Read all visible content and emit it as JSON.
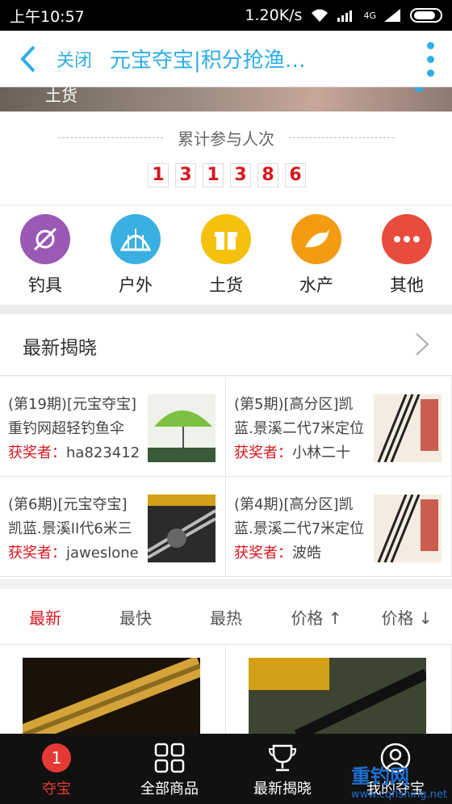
{
  "status_bar": {
    "time": "上午10:57",
    "speed": "1.20K/s",
    "net": "4G"
  },
  "app_bar": {
    "close": "关闭",
    "title": "元宝夺宝|积分抢渔…"
  },
  "banner": {
    "text": "土货"
  },
  "counter": {
    "label": "累计参与人次",
    "digits": [
      "1",
      "3",
      "1",
      "3",
      "8",
      "6"
    ]
  },
  "categories": [
    {
      "label": "钓具",
      "icon": "fishing-gear-icon",
      "color": "#9b59b6"
    },
    {
      "label": "户外",
      "icon": "tent-icon",
      "color": "#3ab0e2"
    },
    {
      "label": "土货",
      "icon": "gift-icon",
      "color": "#f4c20d"
    },
    {
      "label": "水产",
      "icon": "fish-icon",
      "color": "#f39c12"
    },
    {
      "label": "其他",
      "icon": "more-dots-icon",
      "color": "#e74c3c"
    }
  ],
  "latest": {
    "title": "最新揭晓",
    "winner_label": "获奖者：",
    "items": [
      {
        "line1": "(第19期)[元宝夺宝]",
        "line2": "重钓网超轻钓鱼伞",
        "winner": "ha823412"
      },
      {
        "line1": "(第5期)[高分区]凯",
        "line2": "蓝.景溪二代7米定位",
        "winner": "小林二十"
      },
      {
        "line1": "(第6期)[元宝夺宝]",
        "line2": "凯蓝.景溪II代6米三",
        "winner": "jaweslone"
      },
      {
        "line1": "(第4期)[高分区]凯",
        "line2": "蓝.景溪二代7米定位",
        "winner": "波皓"
      }
    ]
  },
  "sorts": [
    "最新",
    "最快",
    "最热",
    "价格",
    "价格"
  ],
  "tabs": [
    {
      "label": "夺宝",
      "badge": "1"
    },
    {
      "label": "全部商品"
    },
    {
      "label": "最新揭晓"
    },
    {
      "label": "我的夺宝"
    }
  ],
  "watermark": {
    "brand": "重钓网",
    "url": "www.cqfishing.net"
  },
  "colors": {
    "accent": "#2eaee8",
    "red": "#d7171f"
  }
}
